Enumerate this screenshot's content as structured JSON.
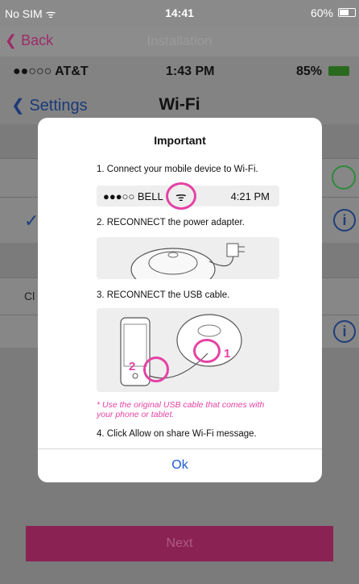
{
  "status": {
    "carrier": "No SIM",
    "time": "14:41",
    "battery": "60%"
  },
  "nav": {
    "back": "Back",
    "title": "Installation"
  },
  "inner": {
    "status": {
      "carrier": "●●○○○ AT&T",
      "time": "1:43 PM",
      "battery": "85%"
    },
    "nav": {
      "back": "Settings",
      "title": "Wi-Fi"
    },
    "row_label": "Cl"
  },
  "modal": {
    "title": "Important",
    "step1": "1. Connect your mobile device to Wi-Fi.",
    "phonebar": {
      "carrier": "●●●○○ BELL",
      "time": "4:21 PM"
    },
    "step2": "2. RECONNECT the power adapter.",
    "step3": "3. RECONNECT the USB cable.",
    "marker1": "1",
    "marker2": "2",
    "note": "* Use the original USB cable that comes with your phone or tablet.",
    "step4": "4. Click Allow on share Wi-Fi message.",
    "ok": "Ok"
  },
  "next": "Next",
  "colors": {
    "accent": "#e542a4",
    "link": "#1e5bd6",
    "brand": "#8a2354"
  }
}
